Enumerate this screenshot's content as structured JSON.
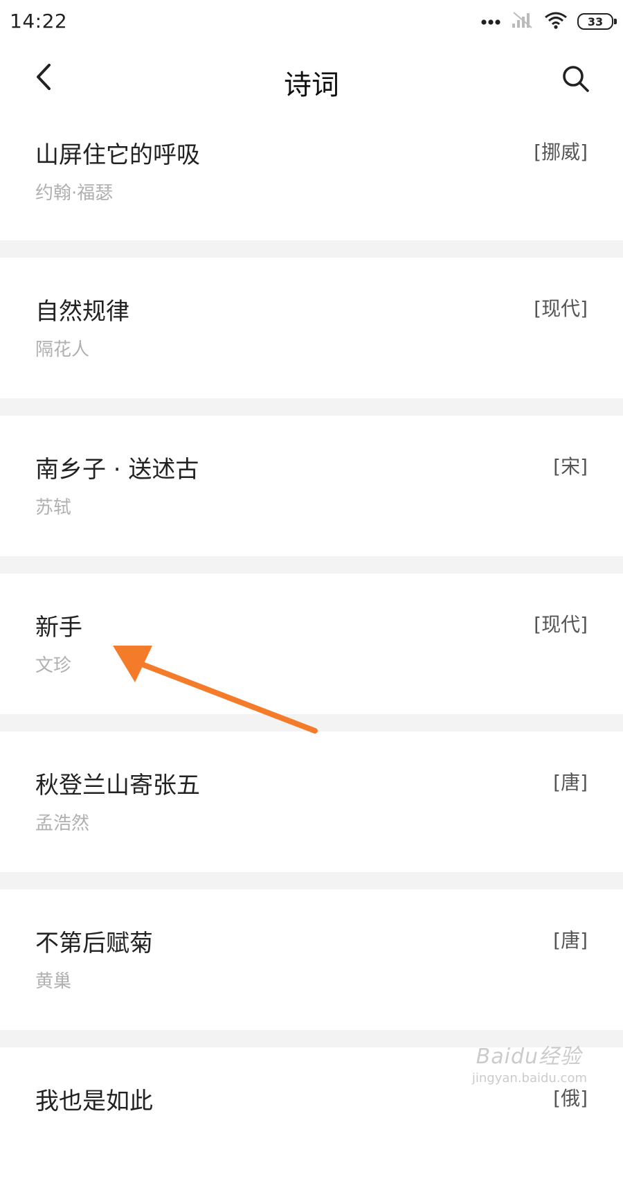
{
  "status": {
    "time": "14:22",
    "battery": "33"
  },
  "header": {
    "title": "诗词",
    "back_icon": "chevron-left-icon",
    "search_icon": "search-icon"
  },
  "poems": [
    {
      "title": "山屏住它的呼吸",
      "author": "约翰·福瑟",
      "dynasty": "[挪威]"
    },
    {
      "title": "自然规律",
      "author": "隔花人",
      "dynasty": "[现代]"
    },
    {
      "title": "南乡子 · 送述古",
      "author": "苏轼",
      "dynasty": "[宋]"
    },
    {
      "title": "新手",
      "author": "文珍",
      "dynasty": "[现代]"
    },
    {
      "title": "秋登兰山寄张五",
      "author": "孟浩然",
      "dynasty": "[唐]"
    },
    {
      "title": "不第后赋菊",
      "author": "黄巢",
      "dynasty": "[唐]"
    },
    {
      "title": "我也是如此",
      "author": "",
      "dynasty": "[俄]"
    }
  ],
  "watermark": {
    "text": "Baidu经验",
    "sub": "jingyan.baidu.com"
  },
  "colors": {
    "annotation_arrow": "#F47B2A",
    "divider": "#F3F3F3",
    "author_text": "#B0B0B0"
  }
}
